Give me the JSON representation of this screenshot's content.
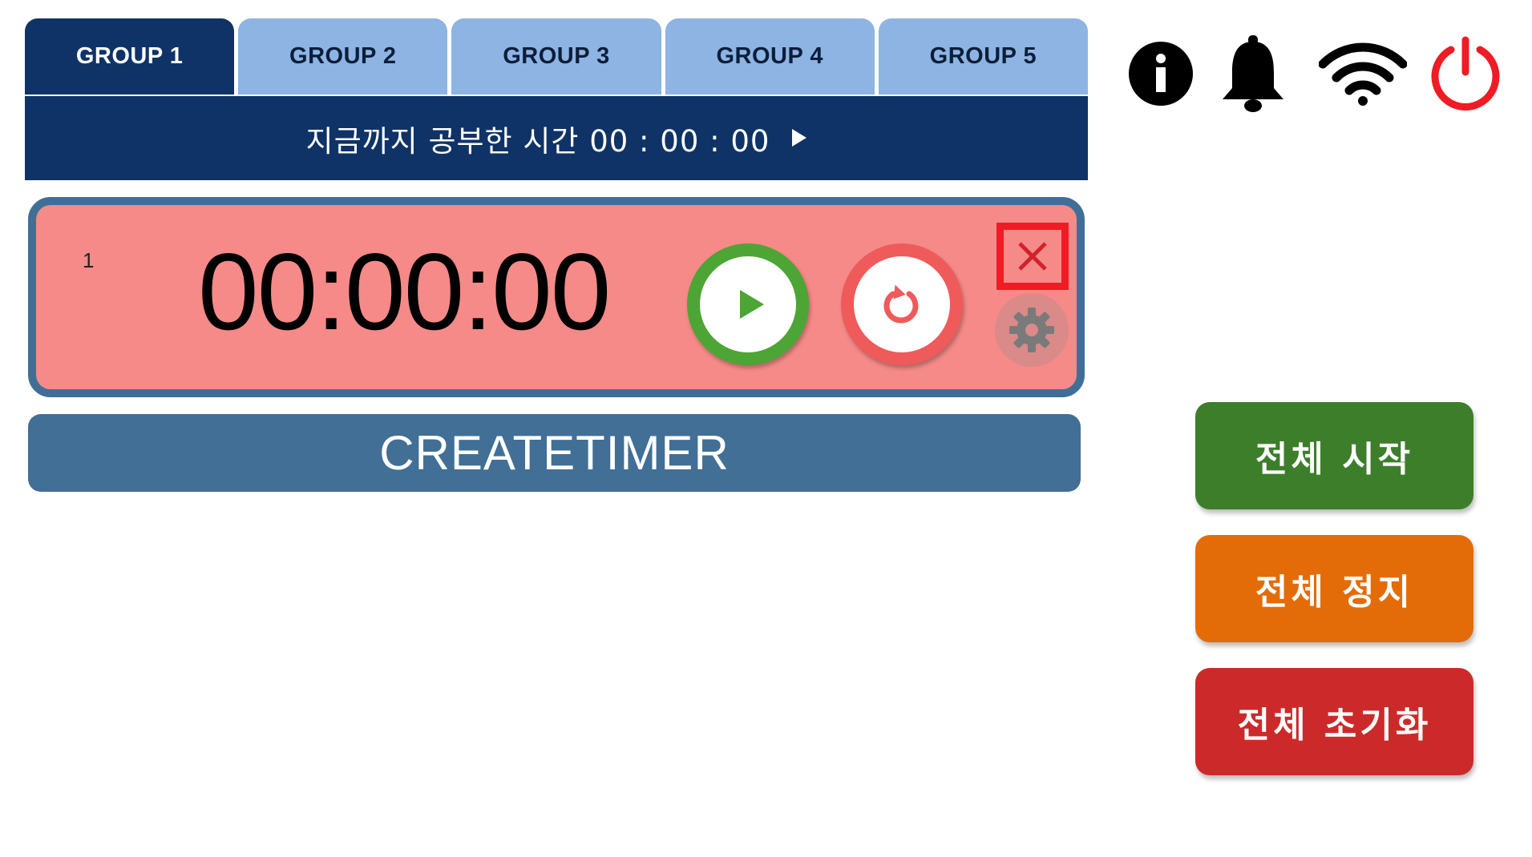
{
  "tabs": [
    {
      "label": "GROUP 1",
      "active": true
    },
    {
      "label": "GROUP 2",
      "active": false
    },
    {
      "label": "GROUP 3",
      "active": false
    },
    {
      "label": "GROUP 4",
      "active": false
    },
    {
      "label": "GROUP 5",
      "active": false
    }
  ],
  "study_bar": {
    "label": "지금까지 공부한 시간",
    "time": "00 : 00 : 00",
    "icon": "play-icon"
  },
  "timer": {
    "index": "1",
    "display": "00:00:00",
    "start_icon": "play-icon",
    "reset_icon": "reset-icon",
    "close_icon": "close-icon",
    "settings_icon": "gear-icon"
  },
  "create_timer": {
    "label": "CREATETIMER"
  },
  "top_icons": [
    "info-icon",
    "bell-icon",
    "wifi-icon",
    "power-icon"
  ],
  "actions": {
    "start_all": "전체 시작",
    "stop_all": "전체 정지",
    "reset_all": "전체 초기화"
  },
  "colors": {
    "navy": "#0f3366",
    "tab_inactive": "#8eb4e4",
    "timer_bg": "#f58a88",
    "timer_border": "#3f6f96",
    "create_btn": "#416f96",
    "green": "#3d7e2b",
    "orange": "#e36c09",
    "red": "#cc2a2a",
    "power_red": "#ee1c24"
  }
}
